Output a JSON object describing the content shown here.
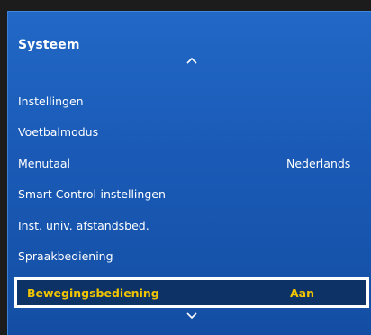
{
  "menu": {
    "title": "Systeem",
    "items": [
      {
        "label": "Instellingen",
        "value": ""
      },
      {
        "label": "Voetbalmodus",
        "value": ""
      },
      {
        "label": "Menutaal",
        "value": "Nederlands"
      },
      {
        "label": "Smart Control-instellingen",
        "value": ""
      },
      {
        "label": "Inst. univ. afstandsbed.",
        "value": ""
      },
      {
        "label": "Spraakbediening",
        "value": ""
      }
    ],
    "selected": {
      "label": "Bewegingsbediening",
      "value": "Aan"
    }
  },
  "icons": {
    "scroll_up": "chevron-up-icon",
    "scroll_down": "chevron-down-icon"
  },
  "colors": {
    "panel_blue": "#1a5ab6",
    "selected_bg": "#0d3366",
    "selected_text": "#f0c400",
    "text": "#ffffff"
  }
}
